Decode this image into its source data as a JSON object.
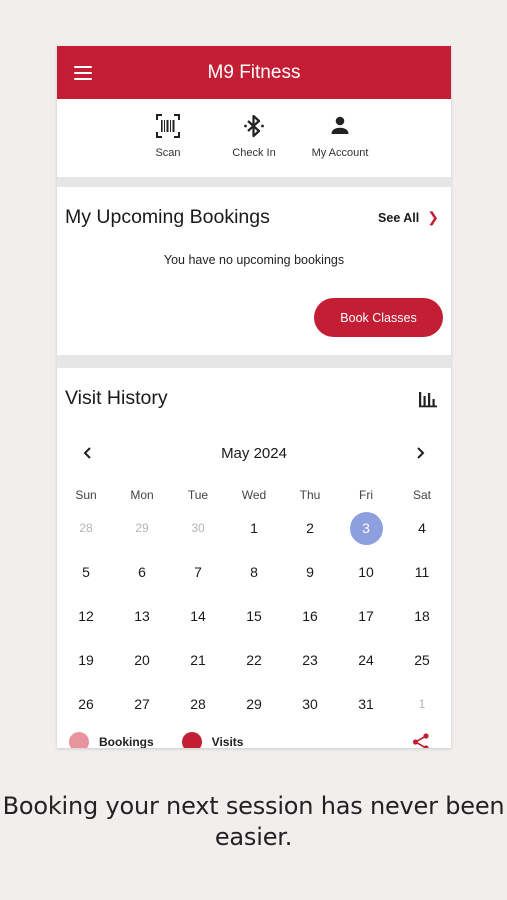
{
  "app": {
    "title": "M9 Fitness"
  },
  "quick_actions": [
    {
      "label": "Scan",
      "icon": "barcode-scan-icon"
    },
    {
      "label": "Check In",
      "icon": "bluetooth-icon"
    },
    {
      "label": "My Account",
      "icon": "person-icon"
    }
  ],
  "bookings": {
    "title": "My Upcoming Bookings",
    "see_all": "See All",
    "empty_text": "You have no upcoming bookings",
    "book_button": "Book Classes"
  },
  "history": {
    "title": "Visit History",
    "month": "May 2024",
    "weekdays": [
      "Sun",
      "Mon",
      "Tue",
      "Wed",
      "Thu",
      "Fri",
      "Sat"
    ],
    "weeks": [
      [
        "28",
        "29",
        "30",
        "1",
        "2",
        "3",
        "4"
      ],
      [
        "5",
        "6",
        "7",
        "8",
        "9",
        "10",
        "11"
      ],
      [
        "12",
        "13",
        "14",
        "15",
        "16",
        "17",
        "18"
      ],
      [
        "19",
        "20",
        "21",
        "22",
        "23",
        "24",
        "25"
      ],
      [
        "26",
        "27",
        "28",
        "29",
        "30",
        "31",
        "1"
      ]
    ],
    "selected_day": "3",
    "legend": [
      {
        "label": "Bookings",
        "color": "#e8949e"
      },
      {
        "label": "Visits",
        "color": "#c41e35"
      }
    ]
  },
  "colors": {
    "brand": "#c41e35",
    "today": "#8e9fe0"
  },
  "caption": "Booking your next session has never been easier."
}
